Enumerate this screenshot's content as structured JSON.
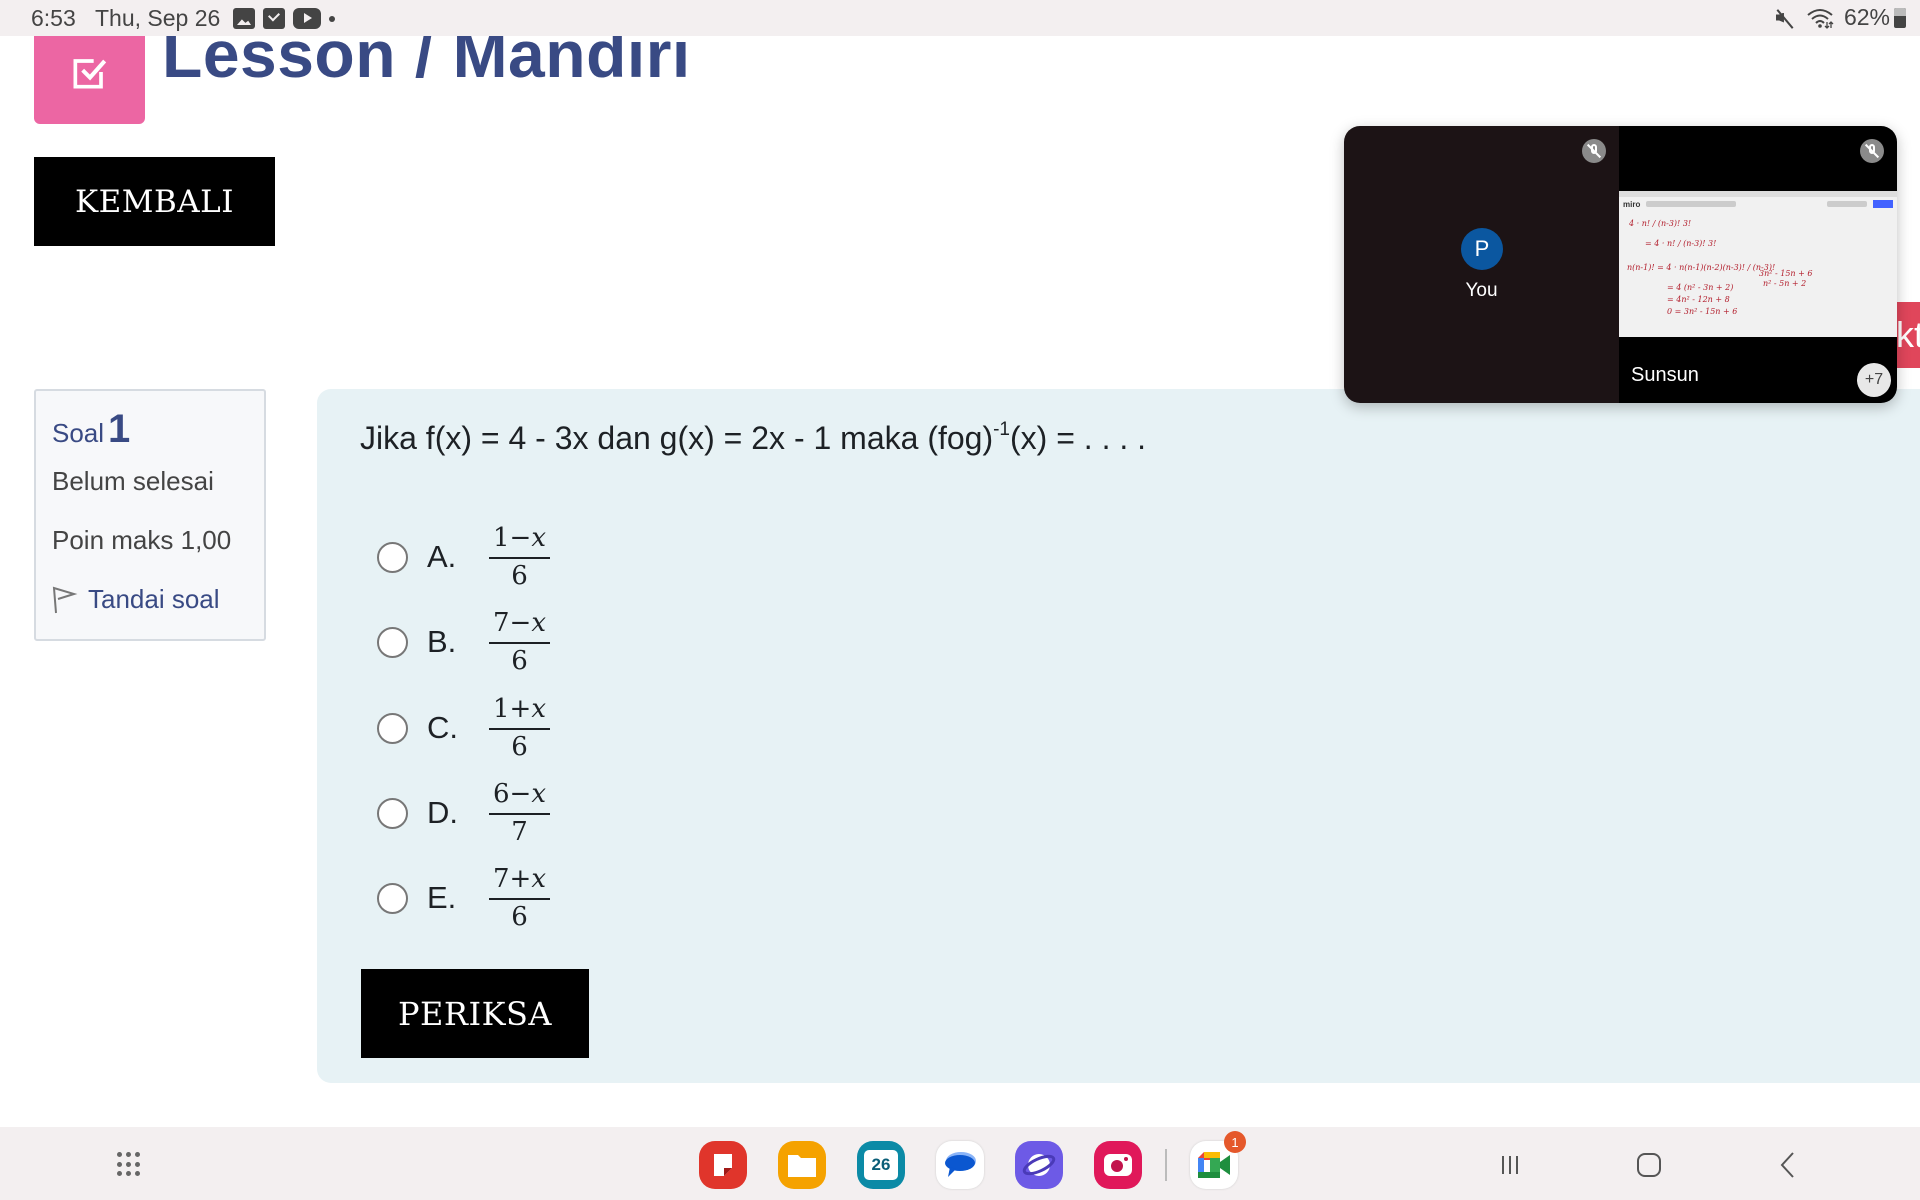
{
  "status_bar": {
    "time": "6:53",
    "date": "Thu, Sep 26",
    "notification_icons": [
      "gallery-icon",
      "checkbox-icon",
      "youtube-icon",
      "more-dot-icon"
    ],
    "right_icons": [
      "mute-icon",
      "wifi-icon",
      "battery-icon"
    ],
    "battery": "62%"
  },
  "header": {
    "title": "Lesson / Mandiri",
    "icon": "check-square-icon",
    "icon_color": "#ec66a3",
    "title_color": "#394a84"
  },
  "buttons": {
    "kembali": "KEMBALI",
    "periksa": "PERIKSA"
  },
  "question_info": {
    "label": "Soal",
    "number": "1",
    "state": "Belum selesai",
    "max_points": "Poin maks 1,00",
    "flag_label": "Tandai soal"
  },
  "question": {
    "text_before": "Jika f(x) = 4 - 3x dan g(x) = 2x - 1 maka (fog)",
    "superscript": "-1",
    "text_after": "(x) = . . . .",
    "options": [
      {
        "letter": "A.",
        "numerator_left": "1",
        "op": "−",
        "var": "x",
        "denominator": "6"
      },
      {
        "letter": "B.",
        "numerator_left": "7",
        "op": "−",
        "var": "x",
        "denominator": "6"
      },
      {
        "letter": "C.",
        "numerator_left": "1",
        "op": "+",
        "var": "x",
        "denominator": "6"
      },
      {
        "letter": "D.",
        "numerator_left": "6",
        "op": "−",
        "var": "x",
        "denominator": "7"
      },
      {
        "letter": "E.",
        "numerator_left": "7",
        "op": "+",
        "var": "x",
        "denominator": "6"
      }
    ]
  },
  "background_tab": {
    "partial_text": "kt"
  },
  "meet_overlay": {
    "self": {
      "avatar_initial": "P",
      "label": "You",
      "mic": "muted"
    },
    "presenter": {
      "name": "Sunsun",
      "mic": "muted",
      "shared_app": "miro"
    },
    "more_participants": "+7",
    "whiteboard_lines": [
      "4 · n! / (n-3)! 3!",
      "= 4 · n! / (n-3)! 3!",
      "n(n-1)! = 4 · n(n-1)(n-2)(n-3)! / (n-3)!",
      "= 4 (n² - 3n + 2)",
      "= 4n² - 12n + 8",
      "0 = 3n² - 15n + 6",
      "3n² - 15n + 6",
      "n² - 5n + 2"
    ]
  },
  "navbar": {
    "apps_button": "apps-grid-icon",
    "dock": [
      {
        "name": "samsung-notes-icon",
        "color": "#e0352b"
      },
      {
        "name": "my-files-icon",
        "color": "#f5a200"
      },
      {
        "name": "calendar-icon",
        "color": "#0b8aa6",
        "label": "26"
      },
      {
        "name": "messages-icon",
        "color": "#ffffff"
      },
      {
        "name": "samsung-internet-icon",
        "color": "#6d5ae6"
      },
      {
        "name": "screen-recorder-icon",
        "color": "#e0185a"
      },
      {
        "name": "google-meet-icon",
        "color": "#ffffff",
        "badge": "1"
      }
    ],
    "nav_buttons": [
      "recents-icon",
      "home-icon",
      "back-icon"
    ]
  }
}
